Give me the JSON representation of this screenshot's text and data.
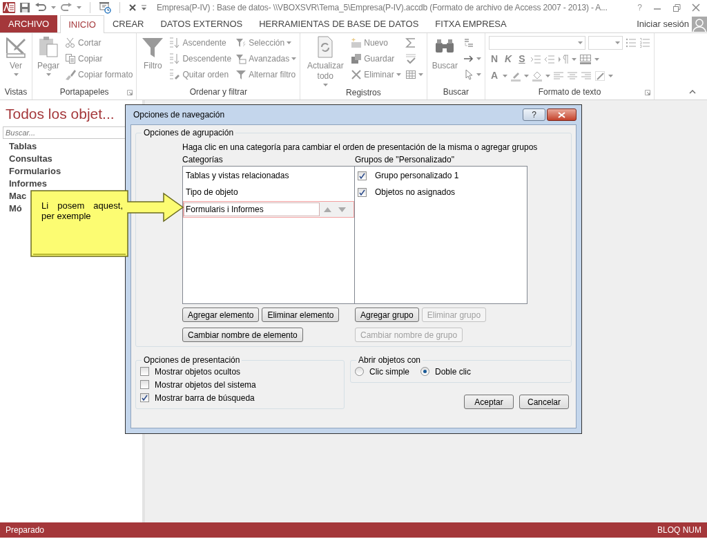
{
  "window": {
    "title": "Empresa(P-IV) : Base de datos- \\\\VBOXSVR\\Tema_5\\Empresa(P-IV).accdb (Formato de archivo de Access 2007 - 2013) - A...",
    "help": "?"
  },
  "tabs": [
    {
      "label": "ARCHIVO",
      "kind": "file",
      "selected": false
    },
    {
      "label": "INICIO",
      "kind": "tab",
      "selected": true
    },
    {
      "label": "CREAR",
      "kind": "tab",
      "selected": false
    },
    {
      "label": "DATOS EXTERNOS",
      "kind": "tab",
      "selected": false
    },
    {
      "label": "HERRAMIENTAS DE BASE DE DATOS",
      "kind": "tab",
      "selected": false
    },
    {
      "label": "FITXA EMPRESA",
      "kind": "tab",
      "selected": false
    }
  ],
  "account": {
    "label": "Iniciar sesión"
  },
  "ribbon": [
    {
      "label": "Vistas",
      "kind": "standard",
      "launcher": false,
      "large": {
        "label": "Ver",
        "dropdown": true
      }
    },
    {
      "label": "Portapapeles",
      "kind": "standard",
      "launcher": true,
      "large": {
        "label": "Pegar",
        "dropdown": true
      },
      "columns": [
        [
          {
            "label": "Cortar",
            "dropdown": false
          },
          {
            "label": "Copiar",
            "dropdown": false
          },
          {
            "label": "Copiar formato",
            "dropdown": false
          }
        ]
      ]
    },
    {
      "label": "Ordenar y filtrar",
      "kind": "standard",
      "launcher": false,
      "large": {
        "label": "Filtro",
        "dropdown": false
      },
      "columns": [
        [
          {
            "label": "Ascendente",
            "dropdown": false
          },
          {
            "label": "Descendente",
            "dropdown": false
          },
          {
            "label": "Quitar orden",
            "dropdown": false
          }
        ],
        [
          {
            "label": "Selección",
            "dropdown": true
          },
          {
            "label": "Avanzadas",
            "dropdown": true
          },
          {
            "label": "Alternar filtro",
            "dropdown": false
          }
        ]
      ]
    },
    {
      "label": "Registros",
      "kind": "standard",
      "launcher": false,
      "large": {
        "label": "Actualizar todo",
        "dropdown": true
      },
      "columns": [
        [
          {
            "label": "Nuevo",
            "dropdown": false
          },
          {
            "label": "Guardar",
            "dropdown": false
          },
          {
            "label": "Eliminar",
            "dropdown": true
          }
        ],
        [
          {
            "dropdown": false
          },
          {
            "dropdown": false
          },
          {
            "dropdown": true
          }
        ]
      ]
    },
    {
      "label": "Buscar",
      "kind": "standard",
      "launcher": false,
      "large": {
        "label": "Buscar",
        "dropdown": false
      },
      "columns": [
        [
          {
            "dropdown": false
          },
          {
            "dropdown": true
          },
          {
            "dropdown": true
          }
        ]
      ]
    },
    {
      "label": "Formato de texto",
      "kind": "text_format",
      "launcher": true,
      "style_letters": [
        "N",
        "K",
        "S"
      ],
      "color_letter": "A"
    }
  ],
  "navigation_pane": {
    "title": "Todos los objet...",
    "search": {
      "placeholder": "Buscar..."
    },
    "items": [
      "Tablas",
      "Consultas",
      "Formularios",
      "Informes",
      "Mac",
      "Mó"
    ]
  },
  "dialog": {
    "title": "Opciones de navegación",
    "help": "?",
    "grouping": {
      "legend": "Opciones de agrupación",
      "instruction": "Haga clic en una categoría para cambiar el orden de presentación de la misma o agregar grupos",
      "categories_label": "Categorías",
      "groups_label": "Grupos de \"Personalizado\"",
      "categories": [
        {
          "label": "Tablas y vistas relacionadas",
          "kind": "text",
          "selected": false
        },
        {
          "label": "Tipo de objeto",
          "kind": "text",
          "selected": false
        },
        {
          "label": "Formularis i Informes",
          "kind": "edit",
          "selected": true
        }
      ],
      "groups": [
        {
          "label": "Grupo personalizado 1",
          "checked": true
        },
        {
          "label": "Objetos no asignados",
          "checked": true
        }
      ],
      "category_buttons": [
        {
          "label": "Agregar elemento",
          "disabled": false
        },
        {
          "label": "Eliminar elemento",
          "disabled": false
        },
        {
          "label": "Cambiar nombre de elemento",
          "disabled": false
        }
      ],
      "group_buttons": [
        {
          "label": "Agregar grupo",
          "disabled": false
        },
        {
          "label": "Eliminar grupo",
          "disabled": true
        },
        {
          "label": "Cambiar nombre de grupo",
          "disabled": true
        }
      ]
    },
    "presentation": {
      "legend": "Opciones de presentación",
      "options": [
        {
          "label": "Mostrar objetos ocultos",
          "checked": false
        },
        {
          "label": "Mostrar objetos del sistema",
          "checked": false
        },
        {
          "label": "Mostrar barra de búsqueda",
          "checked": true
        }
      ]
    },
    "open_with": {
      "legend": "Abrir objetos con",
      "options": [
        {
          "label": "Clic simple",
          "selected": false
        },
        {
          "label": "Doble clic",
          "selected": true
        }
      ]
    },
    "buttons": [
      "Aceptar",
      "Cancelar"
    ]
  },
  "callout": {
    "text": "Li posem aquest, per exemple"
  },
  "status_bar": {
    "left": "Preparado",
    "right": "BLOQ NUM"
  }
}
